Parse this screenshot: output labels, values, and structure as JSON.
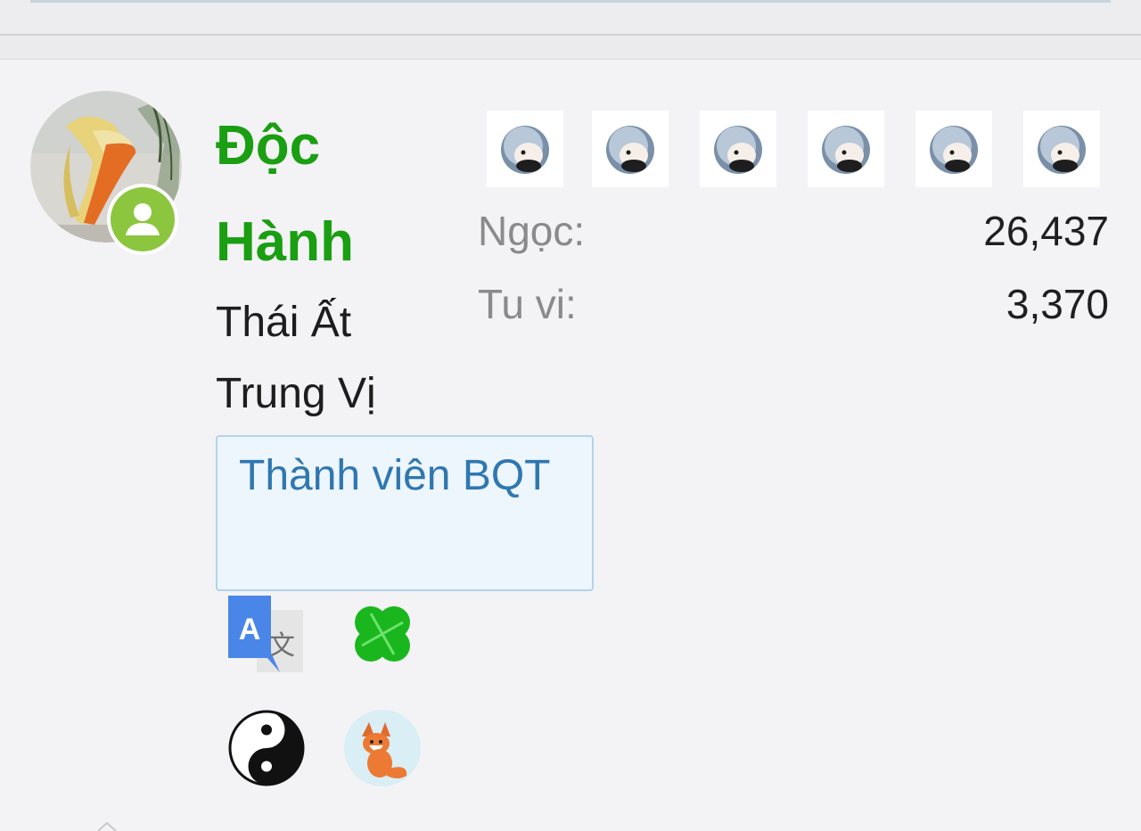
{
  "user": {
    "name": "Độc Hành",
    "rank_title": "Thái Ất Trung Vị",
    "group_label": "Thành viên BQT"
  },
  "stats": [
    {
      "label": "Ngọc:",
      "value": "26,437"
    },
    {
      "label": "Tu vi:",
      "value": "3,370"
    }
  ],
  "medals": [
    {
      "icon": "hooded-cat-medal-icon"
    },
    {
      "icon": "hooded-cat-medal-icon"
    },
    {
      "icon": "hooded-cat-medal-icon"
    },
    {
      "icon": "hooded-cat-medal-icon"
    },
    {
      "icon": "hooded-cat-medal-icon"
    },
    {
      "icon": "hooded-cat-medal-icon"
    }
  ],
  "badges": [
    {
      "icon": "google-translate-icon",
      "letter": "A",
      "glyph": "文"
    },
    {
      "icon": "four-leaf-clover-icon"
    },
    {
      "icon": "yin-yang-icon"
    },
    {
      "icon": "fox-icon"
    }
  ],
  "colors": {
    "username": "#1a9e12",
    "group_text": "#2f77b0",
    "group_bg": "#edf5fd",
    "group_border": "#b3d3ec",
    "online_badge": "#8cc63f",
    "stat_label": "#8a8a8a",
    "stat_value": "#1f1f1f"
  }
}
